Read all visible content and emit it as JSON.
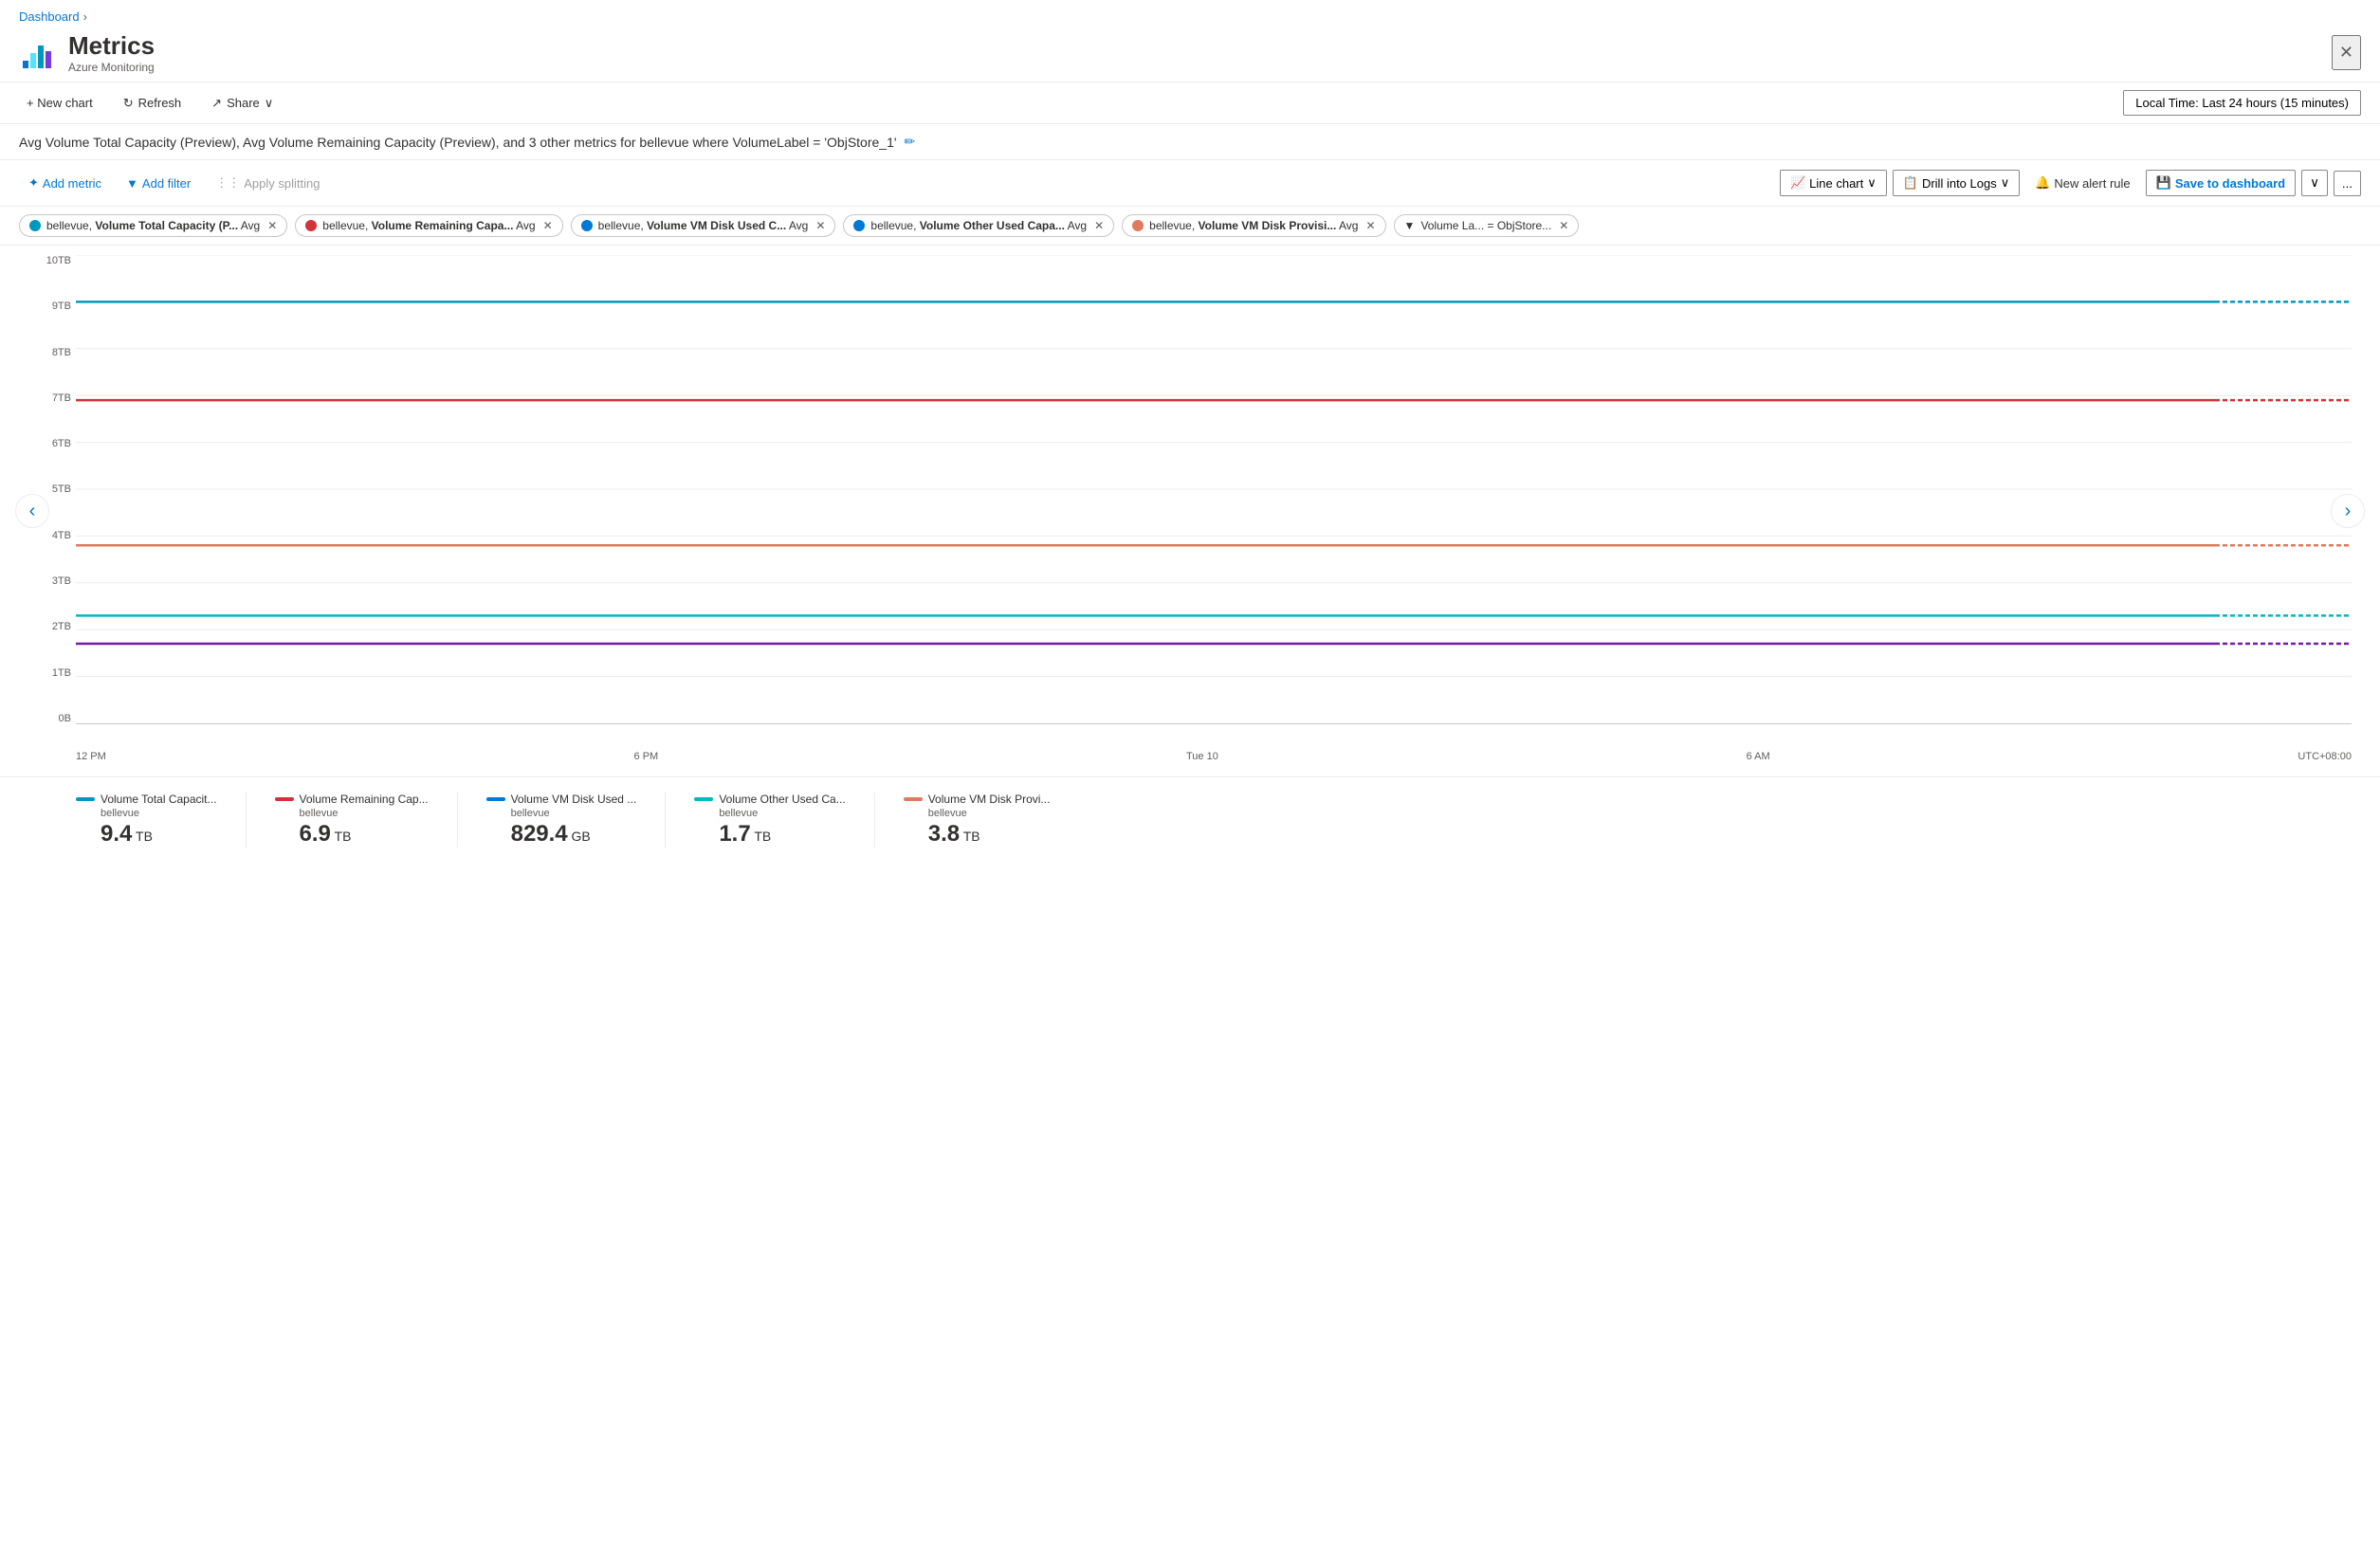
{
  "breadcrumb": {
    "label": "Dashboard",
    "chevron": "›"
  },
  "header": {
    "title": "Metrics",
    "subtitle": "Azure Monitoring",
    "close_label": "✕"
  },
  "toolbar": {
    "new_chart": "+ New chart",
    "refresh": "Refresh",
    "share": "Share",
    "share_chevron": "∨",
    "time_range": "Local Time: Last 24 hours (15 minutes)"
  },
  "chart_title": "Avg Volume Total Capacity (Preview), Avg Volume Remaining Capacity (Preview), and 3 other metrics for bellevue where VolumeLabel = 'ObjStore_1'",
  "metrics_toolbar": {
    "add_metric": "Add metric",
    "add_filter": "Add filter",
    "apply_splitting": "Apply splitting",
    "line_chart": "Line chart",
    "drill_into_logs": "Drill into Logs",
    "new_alert_rule": "New alert rule",
    "save_to_dashboard": "Save to dashboard",
    "more": "..."
  },
  "tags": [
    {
      "id": 1,
      "color": "#0099bc",
      "bold": "Volume Total Capacity (P...",
      "rest": " Avg"
    },
    {
      "id": 2,
      "color": "#d13438",
      "bold": "Volume Remaining Capa...",
      "rest": " Avg"
    },
    {
      "id": 3,
      "color": "#0078d4",
      "bold": "Volume VM Disk Used C...",
      "rest": " Avg"
    },
    {
      "id": 4,
      "color": "#0078d4",
      "bold": "Volume Other Used Capa...",
      "rest": " Avg"
    },
    {
      "id": 5,
      "color": "#e07a5f",
      "bold": "Volume VM Disk Provisi...",
      "rest": " Avg"
    }
  ],
  "filter_tag": {
    "label": "Volume La...",
    "operator": "=",
    "value": "ObjStore..."
  },
  "chart": {
    "y_labels": [
      "10TB",
      "9TB",
      "8TB",
      "7TB",
      "6TB",
      "5TB",
      "4TB",
      "3TB",
      "2TB",
      "1TB",
      "0B"
    ],
    "x_labels": [
      "12 PM",
      "6 PM",
      "Tue 10",
      "6 AM",
      "UTC+08:00"
    ],
    "lines": [
      {
        "color": "#0099bc",
        "top_pct": 12,
        "label": "volume-total"
      },
      {
        "color": "#d13438",
        "top_pct": 33,
        "label": "volume-remaining"
      },
      {
        "color": "#e07a5f",
        "top_pct": 63,
        "label": "volume-other-used"
      },
      {
        "color": "#00b7c3",
        "top_pct": 77,
        "label": "volume-vm-disk-used"
      },
      {
        "color": "#7719aa",
        "top_pct": 83,
        "label": "volume-vm-disk-provisioned"
      }
    ]
  },
  "legend": [
    {
      "color": "#0099bc",
      "name": "Volume Total Capacit...",
      "sub": "bellevue",
      "value": "9.4",
      "unit": "TB"
    },
    {
      "color": "#d13438",
      "name": "Volume Remaining Cap...",
      "sub": "bellevue",
      "value": "6.9",
      "unit": "TB"
    },
    {
      "color": "#0078d4",
      "name": "Volume VM Disk Used ...",
      "sub": "bellevue",
      "value": "829.4",
      "unit": "GB"
    },
    {
      "color": "#e07a5f",
      "name": "Volume Other Used Ca...",
      "sub": "bellevue",
      "value": "1.7",
      "unit": "TB"
    },
    {
      "color": "#e07a5f",
      "name": "Volume VM Disk Provi...",
      "sub": "bellevue",
      "value": "3.8",
      "unit": "TB"
    }
  ]
}
